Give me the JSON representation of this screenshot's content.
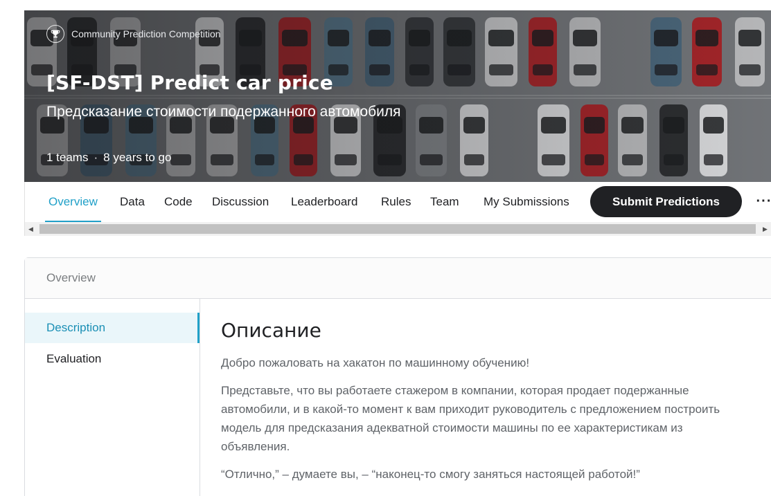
{
  "header": {
    "kicker": "Community Prediction Competition",
    "kicker_icon": "trophy-icon",
    "title": "[SF-DST] Predict car price",
    "subtitle": "Предсказание стоимости подержанного автомобиля",
    "teams": "1 teams",
    "separator": "·",
    "time_left": "8 years to go"
  },
  "tabs": {
    "items": [
      {
        "label": "Overview",
        "active": true
      },
      {
        "label": "Data",
        "active": false
      },
      {
        "label": "Code",
        "active": false
      },
      {
        "label": "Discussion",
        "active": false
      },
      {
        "label": "Leaderboard",
        "active": false
      },
      {
        "label": "Rules",
        "active": false
      },
      {
        "label": "Team",
        "active": false
      },
      {
        "label": "My Submissions",
        "active": false
      }
    ],
    "submit_label": "Submit Predictions",
    "more_icon": "more-horizontal-icon"
  },
  "card": {
    "heading": "Overview",
    "sidebar": [
      {
        "label": "Description",
        "active": true
      },
      {
        "label": "Evaluation",
        "active": false
      }
    ],
    "content": {
      "title": "Описание",
      "paragraphs": [
        "Добро пожаловать на хакатон по машинному обучению!",
        "Представьте, что вы работаете стажером в компании, которая продает подержанные автомобили, и в какой-то момент к вам приходит руководитель с предложением построить модель для предсказания адекватной стоимости машины по ее характеристикам из объявления.",
        "“Отлично,” – думаете вы, – “наконец-то смогу заняться настоящей работой!”"
      ]
    }
  },
  "colors": {
    "accent": "#20a0c8",
    "button_dark": "#202124",
    "active_bg": "#eaf6fa"
  }
}
